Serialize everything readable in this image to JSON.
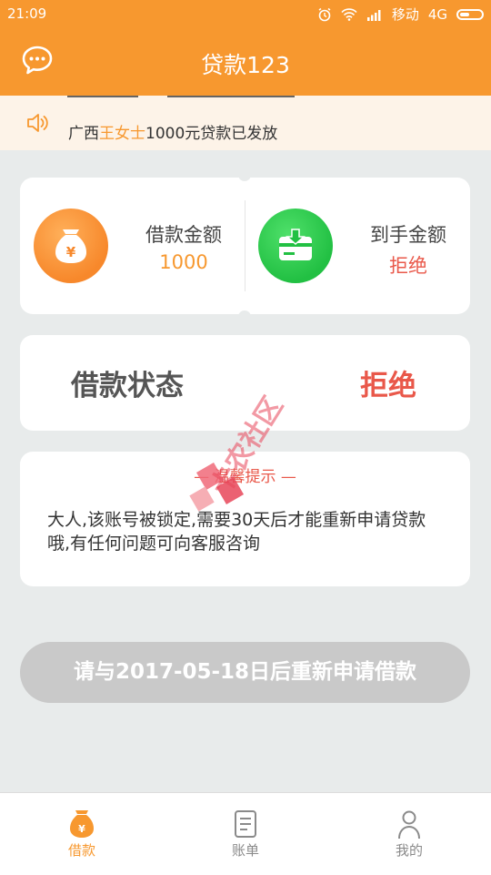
{
  "status_bar": {
    "time": "21:09",
    "carrier": "移动",
    "network": "4G"
  },
  "header": {
    "title": "贷款123",
    "chat_icon": "chat-bubble-icon"
  },
  "notice": {
    "icon": "speaker-icon",
    "prefix": "广西",
    "highlight": "王女士",
    "suffix": "1000元贷款已发放"
  },
  "amounts": {
    "borrow_label": "借款金额",
    "borrow_value": "1000",
    "received_label": "到手金额",
    "received_value": "拒绝"
  },
  "status": {
    "label": "借款状态",
    "value": "拒绝"
  },
  "tip": {
    "title": "— 温馨提示 —",
    "body": "大人,该账号被锁定,需要30天后才能重新申请贷款哦,有任何问题可向客服咨询"
  },
  "action_button": {
    "label": "请与2017-05-18日后重新申请借款"
  },
  "watermark": {
    "text": "卡农社区"
  },
  "tabs": [
    {
      "label": "借款",
      "icon": "money-bag-icon",
      "active": true
    },
    {
      "label": "账单",
      "icon": "bill-icon",
      "active": false
    },
    {
      "label": "我的",
      "icon": "user-icon",
      "active": false
    }
  ],
  "colors": {
    "primary": "#f7982f",
    "reject": "#e9584a",
    "success": "#22c043",
    "disabled": "#c9c9c9"
  }
}
